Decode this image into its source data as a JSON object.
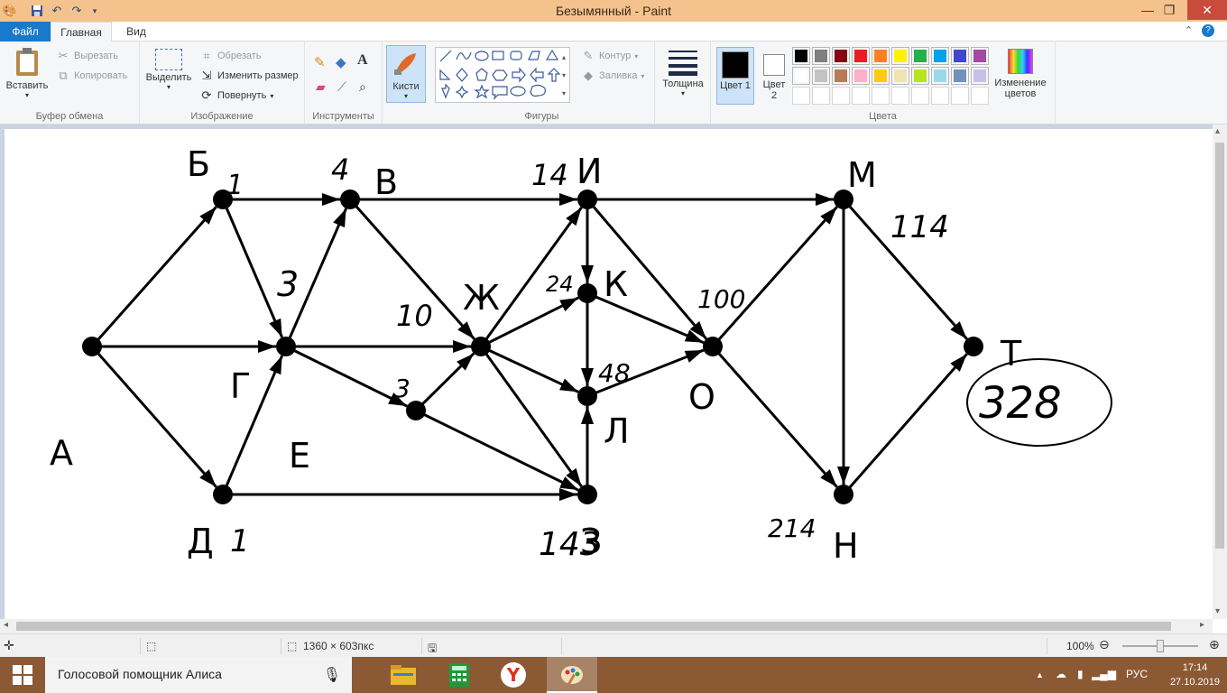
{
  "window": {
    "title": "Безымянный - Paint"
  },
  "tabs": {
    "file": "Файл",
    "home": "Главная",
    "view": "Вид"
  },
  "ribbon": {
    "clipboard": {
      "paste": "Вставить",
      "cut": "Вырезать",
      "copy": "Копировать",
      "label": "Буфер обмена"
    },
    "image": {
      "select": "Выделить",
      "crop": "Обрезать",
      "resize": "Изменить размер",
      "rotate": "Повернуть",
      "label": "Изображение"
    },
    "tools": {
      "label": "Инструменты"
    },
    "brushes": {
      "label": "Кисти"
    },
    "shapes": {
      "outline": "Контур",
      "fill": "Заливка",
      "label": "Фигуры"
    },
    "size": {
      "label": "Толщина"
    },
    "colors": {
      "color1": "Цвет 1",
      "color2": "Цвет 2",
      "edit": "Изменение цветов",
      "label": "Цвета",
      "palette_row1": [
        "#000000",
        "#7f7f7f",
        "#880015",
        "#ed1c24",
        "#ff7f27",
        "#fff200",
        "#22b14c",
        "#00a2e8",
        "#3f48cc",
        "#a349a4"
      ],
      "palette_row2": [
        "#ffffff",
        "#c3c3c3",
        "#b97a57",
        "#ffaec9",
        "#ffc90e",
        "#efe4b0",
        "#b5e61d",
        "#99d9ea",
        "#7092be",
        "#c8bfe7"
      ]
    }
  },
  "drawing": {
    "vertex_labels": [
      "А",
      "Б",
      "В",
      "Г",
      "Д",
      "Е",
      "Ж",
      "И",
      "К",
      "Л",
      "З",
      "О",
      "М",
      "Н",
      "Т"
    ],
    "handwritten_numbers": {
      "B": "1",
      "V": "4",
      "G": "3",
      "D": "1",
      "E": "3",
      "Zh": "10",
      "I": "14",
      "K": "24",
      "L": "48",
      "Z": "143",
      "O": "100",
      "M": "114",
      "N": "214",
      "T": "328"
    }
  },
  "status": {
    "size": "1360 × 603пкс",
    "zoom": "100%"
  },
  "taskbar": {
    "search": "Голосовой помощник Алиса",
    "lang": "РУС",
    "time": "17:14",
    "date": "27.10.2019"
  }
}
